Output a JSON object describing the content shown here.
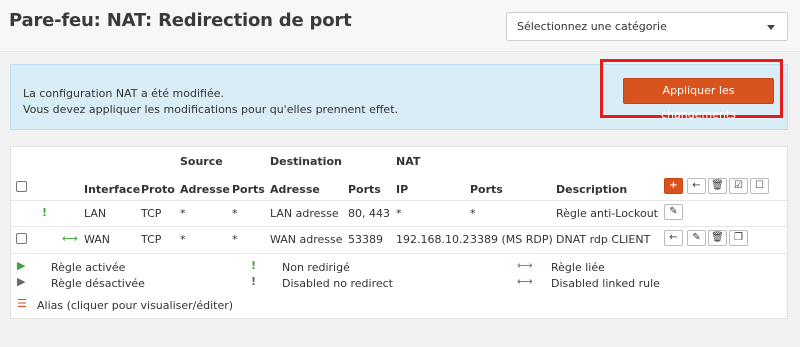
{
  "header": {
    "title": "Pare-feu: NAT: Redirection de port",
    "category_select": "Sélectionnez une catégorie"
  },
  "alert": {
    "line1": "La configuration NAT a été modifiée.",
    "line2": "Vous devez appliquer les modifications pour qu'elles prennent effet.",
    "apply_label": "Appliquer les changements"
  },
  "table": {
    "groups": {
      "source": "Source",
      "destination": "Destination",
      "nat": "NAT"
    },
    "columns": {
      "interface": "Interface",
      "proto": "Proto",
      "src_addr": "Adresse",
      "src_ports": "Ports",
      "dst_addr": "Adresse",
      "dst_ports": "Ports",
      "nat_ip": "IP",
      "nat_ports": "Ports",
      "description": "Description"
    },
    "rows": [
      {
        "interface": "LAN",
        "proto": "TCP",
        "src_addr": "*",
        "src_ports": "*",
        "dst_addr": "LAN adresse",
        "dst_ports": "80, 443",
        "nat_ip": "*",
        "nat_ports": "*",
        "description": "Règle anti-Lockout"
      },
      {
        "interface": "WAN",
        "proto": "TCP",
        "src_addr": "*",
        "src_ports": "*",
        "dst_addr": "WAN adresse",
        "dst_ports": "53389",
        "nat_ip": "192.168.10.2",
        "nat_ports": "3389 (MS RDP)",
        "description": "DNAT rdp CLIENT"
      }
    ]
  },
  "legend": {
    "enabled": "Règle activée",
    "disabled": "Règle désactivée",
    "no_redirect": "Non redirigé",
    "disabled_no_redirect": "Disabled no redirect",
    "linked": "Règle liée",
    "disabled_linked": "Disabled linked rule",
    "alias": "Alias (cliquer pour visualiser/éditer)"
  },
  "colors": {
    "accent": "#d9531e",
    "highlight_box": "#e51c1c",
    "alert_bg": "#d9edf7",
    "status_green": "#3fa535"
  }
}
